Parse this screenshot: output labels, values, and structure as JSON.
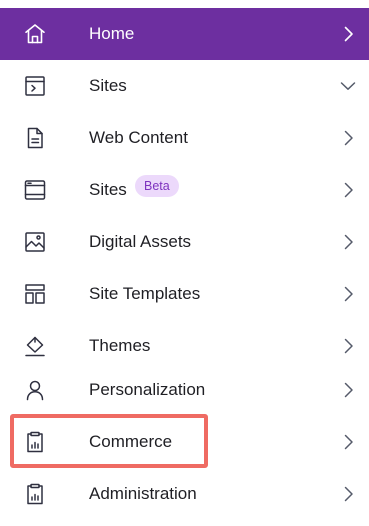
{
  "nav": {
    "items": [
      {
        "label": "Home",
        "icon": "home-icon",
        "chevron": "chevron-right-icon"
      },
      {
        "label": "Sites",
        "icon": "terminal-window-icon",
        "chevron": "chevron-down-icon"
      },
      {
        "label": "Web Content",
        "icon": "document-icon",
        "chevron": "chevron-right-icon"
      },
      {
        "label": "Sites",
        "badge": "Beta",
        "icon": "site-pages-icon",
        "chevron": "chevron-right-icon"
      },
      {
        "label": "Digital Assets",
        "icon": "image-icon",
        "chevron": "chevron-right-icon"
      },
      {
        "label": "Site Templates",
        "icon": "template-icon",
        "chevron": "chevron-right-icon"
      },
      {
        "label": "Themes",
        "icon": "paint-bucket-icon",
        "chevron": "chevron-right-icon"
      },
      {
        "label": "Personalization",
        "icon": "user-icon",
        "chevron": "chevron-right-icon"
      },
      {
        "label": "Commerce",
        "icon": "clipboard-chart-icon",
        "chevron": "chevron-right-icon"
      },
      {
        "label": "Administration",
        "icon": "clipboard-chart-icon",
        "chevron": "chevron-right-icon"
      }
    ],
    "active_index": 0,
    "highlighted_index": 8
  },
  "colors": {
    "active_background": "#6d2fa0",
    "active_text": "#ffffff",
    "text": "#1f1f24",
    "icon": "#2f3040",
    "chevron": "#555b6a",
    "badge_background": "#ecd9fb",
    "badge_text": "#7e32bf",
    "highlight_border": "#ef6b63"
  }
}
